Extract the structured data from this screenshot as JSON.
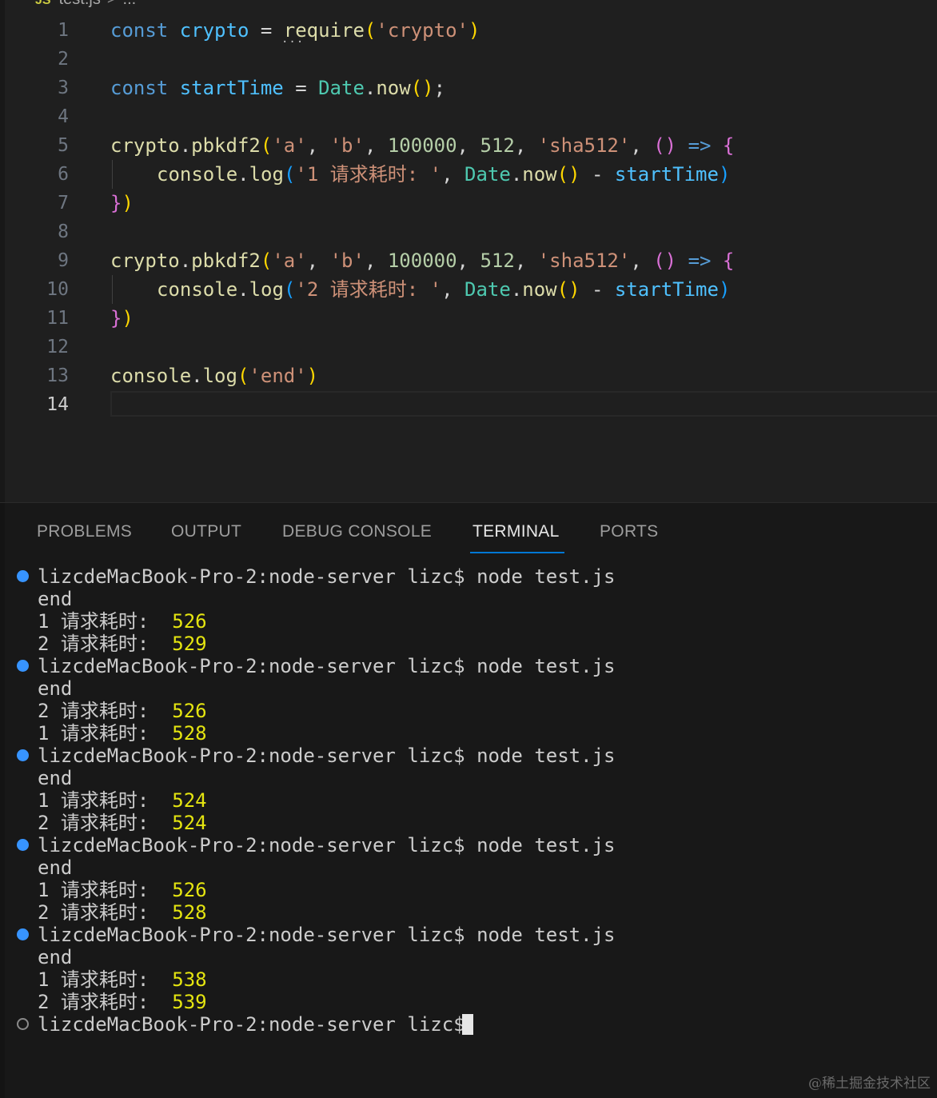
{
  "breadcrumb": {
    "file": "test.js",
    "sep": ">",
    "rest": "..."
  },
  "editor": {
    "line_numbers": [
      "1",
      "2",
      "3",
      "4",
      "5",
      "6",
      "7",
      "8",
      "9",
      "10",
      "11",
      "12",
      "13",
      "14"
    ],
    "current_line": "14",
    "code": {
      "l1": {
        "kw": "const",
        "var": "crypto",
        "eq": " = ",
        "fn": "require",
        "p_open": "(",
        "str": "'crypto'",
        "p_close": ")"
      },
      "l3": {
        "kw": "const",
        "var": "startTime",
        "eq": " = ",
        "cls": "Date",
        "dot": ".",
        "fn": "now",
        "paren": "()",
        "semi": ";"
      },
      "l5": {
        "obj": "crypto",
        "dot": ".",
        "fn": "pbkdf2",
        "p_open": "(",
        "s1": "'a'",
        "c1": ", ",
        "s2": "'b'",
        "c2": ", ",
        "n1": "100000",
        "c3": ", ",
        "n2": "512",
        "c4": ", ",
        "s3": "'sha512'",
        "c5": ", ",
        "args": "()",
        "arrow": " => ",
        "brace": "{"
      },
      "l6": {
        "obj": "console",
        "dot": ".",
        "fn": "log",
        "p_open": "(",
        "str": "'1 请求耗时: '",
        "c1": ", ",
        "cls": "Date",
        "dot2": ".",
        "fn2": "now",
        "paren": "()",
        "minus": " - ",
        "var": "startTime",
        "p_close": ")"
      },
      "l7": {
        "brace": "}",
        "paren": ")"
      },
      "l9": {
        "obj": "crypto",
        "dot": ".",
        "fn": "pbkdf2",
        "p_open": "(",
        "s1": "'a'",
        "c1": ", ",
        "s2": "'b'",
        "c2": ", ",
        "n1": "100000",
        "c3": ", ",
        "n2": "512",
        "c4": ", ",
        "s3": "'sha512'",
        "c5": ", ",
        "args": "()",
        "arrow": " => ",
        "brace": "{"
      },
      "l10": {
        "obj": "console",
        "dot": ".",
        "fn": "log",
        "p_open": "(",
        "str": "'2 请求耗时: '",
        "c1": ", ",
        "cls": "Date",
        "dot2": ".",
        "fn2": "now",
        "paren": "()",
        "minus": " - ",
        "var": "startTime",
        "p_close": ")"
      },
      "l11": {
        "brace": "}",
        "paren": ")"
      },
      "l13": {
        "obj": "console",
        "dot": ".",
        "fn": "log",
        "p_open": "(",
        "str": "'end'",
        "p_close": ")"
      }
    },
    "hint_dots": "..."
  },
  "panel": {
    "tabs": [
      "PROBLEMS",
      "OUTPUT",
      "DEBUG CONSOLE",
      "TERMINAL",
      "PORTS"
    ],
    "active_tab": "TERMINAL",
    "terminal": {
      "prompt": "lizcdeMacBook-Pro-2:node-server lizc$",
      "command": "node test.js",
      "label": "请求耗时:",
      "runs": [
        {
          "output": "end",
          "results": [
            {
              "id": "1",
              "ms": "526"
            },
            {
              "id": "2",
              "ms": "529"
            }
          ]
        },
        {
          "output": "end",
          "results": [
            {
              "id": "2",
              "ms": "526"
            },
            {
              "id": "1",
              "ms": "528"
            }
          ]
        },
        {
          "output": "end",
          "results": [
            {
              "id": "1",
              "ms": "524"
            },
            {
              "id": "2",
              "ms": "524"
            }
          ]
        },
        {
          "output": "end",
          "results": [
            {
              "id": "1",
              "ms": "526"
            },
            {
              "id": "2",
              "ms": "528"
            }
          ]
        },
        {
          "output": "end",
          "results": [
            {
              "id": "1",
              "ms": "538"
            },
            {
              "id": "2",
              "ms": "539"
            }
          ]
        }
      ]
    }
  },
  "watermark": "@稀土掘金技术社区",
  "colors": {
    "background": "#1f1f1f",
    "panel_background": "#181818",
    "accent": "#0078d4",
    "terminal_number": "#e5e510",
    "decoration_dot": "#3794ff"
  }
}
